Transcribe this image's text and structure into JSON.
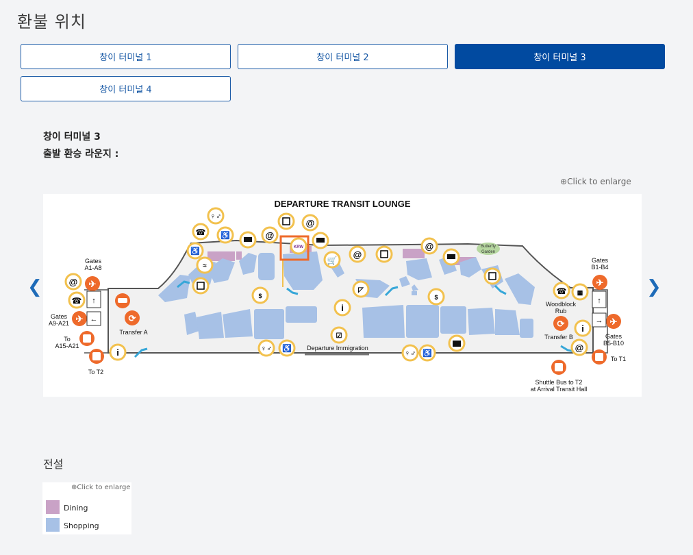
{
  "page": {
    "title": "환불 위치"
  },
  "tabs": [
    {
      "label": "창이 터미널 1",
      "active": false
    },
    {
      "label": "창이 터미널 2",
      "active": false
    },
    {
      "label": "창이 터미널 3",
      "active": true
    },
    {
      "label": "창이 터미널 4",
      "active": false
    }
  ],
  "info": {
    "terminal": "창이 터미널 3",
    "lounge": "출발 환승 라운지 :"
  },
  "map": {
    "enlarge": "Click to enlarge",
    "heading": "DEPARTURE TRANSIT LOUNGE",
    "labels": {
      "gates_a1_a8_1": "Gates",
      "gates_a1_a8_2": "A1-A8",
      "gates_a9_a21_1": "Gates",
      "gates_a9_a21_2": "A9-A21",
      "to_a15_a21_1": "To",
      "to_a15_a21_2": "A15-A21",
      "to_t2": "To T2",
      "transfer_a": "Transfer A",
      "departure_immigration": "Departure Immigration",
      "butterfly_garden_1": "Butterfly",
      "butterfly_garden_2": "Garden",
      "gates_b1_b4_1": "Gates",
      "gates_b1_b4_2": "B1-B4",
      "woodblock_rub_1": "Woodblock",
      "woodblock_rub_2": "Rub",
      "transfer_b": "Transfer B",
      "gates_b5_b10_1": "Gates",
      "gates_b5_b10_2": "B5-B10",
      "to_t1": "To T1",
      "shuttle_1": "Shuttle Bus to T2",
      "shuttle_2": "at Arrival Transit Hall"
    },
    "colors": {
      "dining": "#c9a2c6",
      "shopping": "#a7c1e6",
      "icon_ring": "#f2c14e",
      "orange": "#ee6a2b"
    }
  },
  "legend": {
    "title": "전설",
    "enlarge": "Click to enlarge",
    "items": [
      {
        "label": "Dining"
      },
      {
        "label": "Shopping"
      }
    ]
  }
}
